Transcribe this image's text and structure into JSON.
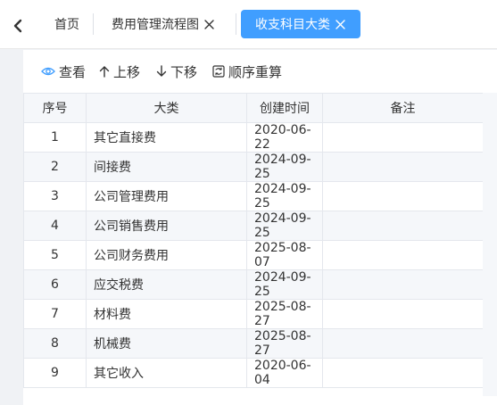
{
  "tabs": {
    "home_label": "首页",
    "flow_label": "费用管理流程图",
    "active_label": "收支科目大类"
  },
  "toolbar": {
    "view_label": "查看",
    "move_up_label": "上移",
    "move_down_label": "下移",
    "reorder_label": "顺序重算"
  },
  "table": {
    "columns": [
      "序号",
      "大类",
      "创建时间",
      "备注"
    ],
    "rows": [
      {
        "no": "1",
        "name": "其它直接费",
        "date": "2020-06-22",
        "remark": ""
      },
      {
        "no": "2",
        "name": "间接费",
        "date": "2024-09-25",
        "remark": ""
      },
      {
        "no": "3",
        "name": "公司管理费用",
        "date": "2024-09-25",
        "remark": ""
      },
      {
        "no": "4",
        "name": "公司销售费用",
        "date": "2024-09-25",
        "remark": ""
      },
      {
        "no": "5",
        "name": "公司财务费用",
        "date": "2025-08-07",
        "remark": ""
      },
      {
        "no": "6",
        "name": "应交税费",
        "date": "2024-09-25",
        "remark": ""
      },
      {
        "no": "7",
        "name": "材料费",
        "date": "2025-08-27",
        "remark": ""
      },
      {
        "no": "8",
        "name": "机械费",
        "date": "2025-08-27",
        "remark": ""
      },
      {
        "no": "9",
        "name": "其它收入",
        "date": "2020-06-04",
        "remark": ""
      }
    ]
  },
  "colors": {
    "accent": "#409eff",
    "view_icon": "#409eff",
    "stripe": "#f5f7fa",
    "border": "#e4e7ed"
  },
  "icons": {
    "back": "chevron-left-icon",
    "close": "close-icon",
    "view": "eye-icon",
    "move_up": "arrow-up-icon",
    "move_down": "arrow-down-icon",
    "reorder": "reorder-icon"
  }
}
